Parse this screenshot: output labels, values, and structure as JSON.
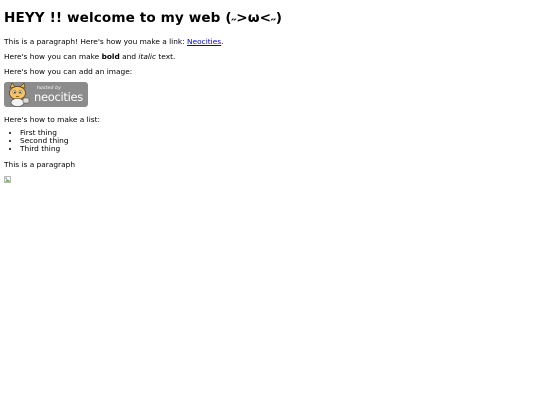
{
  "heading": "HEYY !! welcome to my web (˶>ω<˶)",
  "paragraph_link": {
    "before": "This is a paragraph! Here's how you make a link: ",
    "link_text": "Neocities",
    "after": "."
  },
  "bold_italic": {
    "before": "Here's how you can make ",
    "bold": "bold",
    "middle": " and ",
    "italic": "italic",
    "after": " text."
  },
  "image_intro": "Here's how you can add an image:",
  "badge": {
    "small_text": "hosted by",
    "big_text": "neocities"
  },
  "list_intro": "Here's how to make a list:",
  "list_items": [
    "First thing",
    "Second thing",
    "Third thing"
  ],
  "closing_paragraph": "This is a paragraph"
}
